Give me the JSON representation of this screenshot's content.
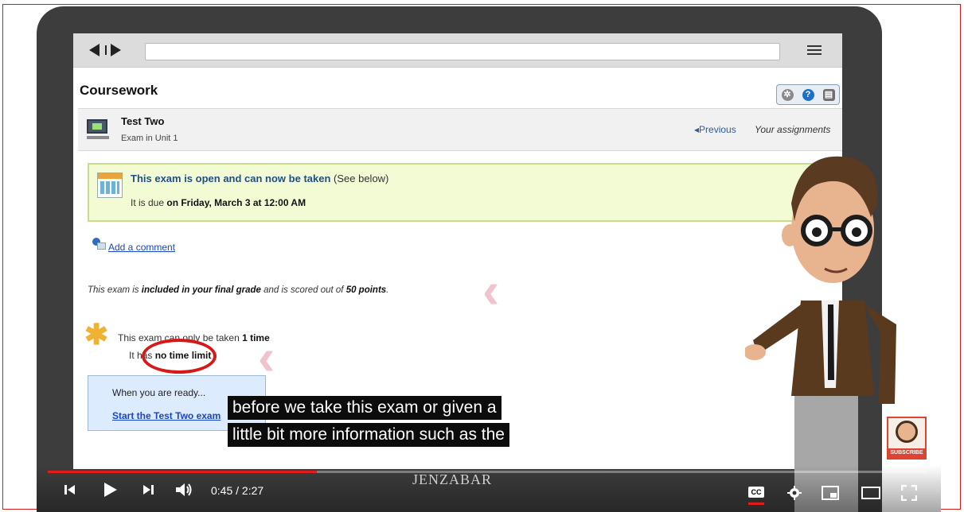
{
  "browser": {
    "url": ""
  },
  "page": {
    "title": "Coursework"
  },
  "assignment": {
    "title": "Test Two",
    "subtitle": "Exam in Unit 1",
    "previous_label": "◂Previous",
    "your_assignments_label": "Your assignments"
  },
  "status_box": {
    "headline": "This exam is open and can now be taken",
    "see_below": " (See below)",
    "due_prefix": "It is due ",
    "due_date": "on Friday, March 3 at 12:00 AM"
  },
  "comment": {
    "link_label": "Add a comment"
  },
  "grading": {
    "prefix": "This exam is ",
    "included": "included in your final grade",
    "middle": " and is scored out of ",
    "points": "50 points",
    "suffix": "."
  },
  "attempts": {
    "prefix": "This exam can only be taken ",
    "count": "1 time",
    "limit_prefix": "It has ",
    "limit": "no time limit"
  },
  "ready": {
    "text": "When you are ready...",
    "start_link": "Start the Test Two exam"
  },
  "captions": {
    "line1": "before we take this exam or given a",
    "line2": "little bit more information such as the"
  },
  "player": {
    "current_time": "0:45",
    "duration": "2:27",
    "time_display": "0:45 / 2:27",
    "progress_fraction": 0.306,
    "brand": "JENZABAR",
    "cc_label": "CC",
    "subscribe_label": "SUBSCRIBE",
    "accent_color": "#e21b1b"
  },
  "icons": {
    "back": "triangle-left-icon",
    "forward": "triangle-right-icon",
    "menu": "hamburger-icon",
    "settings": "gear-icon",
    "help": "help-icon",
    "print": "print-icon",
    "exam": "computer-icon",
    "calendar": "calendar-icon",
    "comment": "comment-icon",
    "asterisk": "asterisk-icon"
  }
}
